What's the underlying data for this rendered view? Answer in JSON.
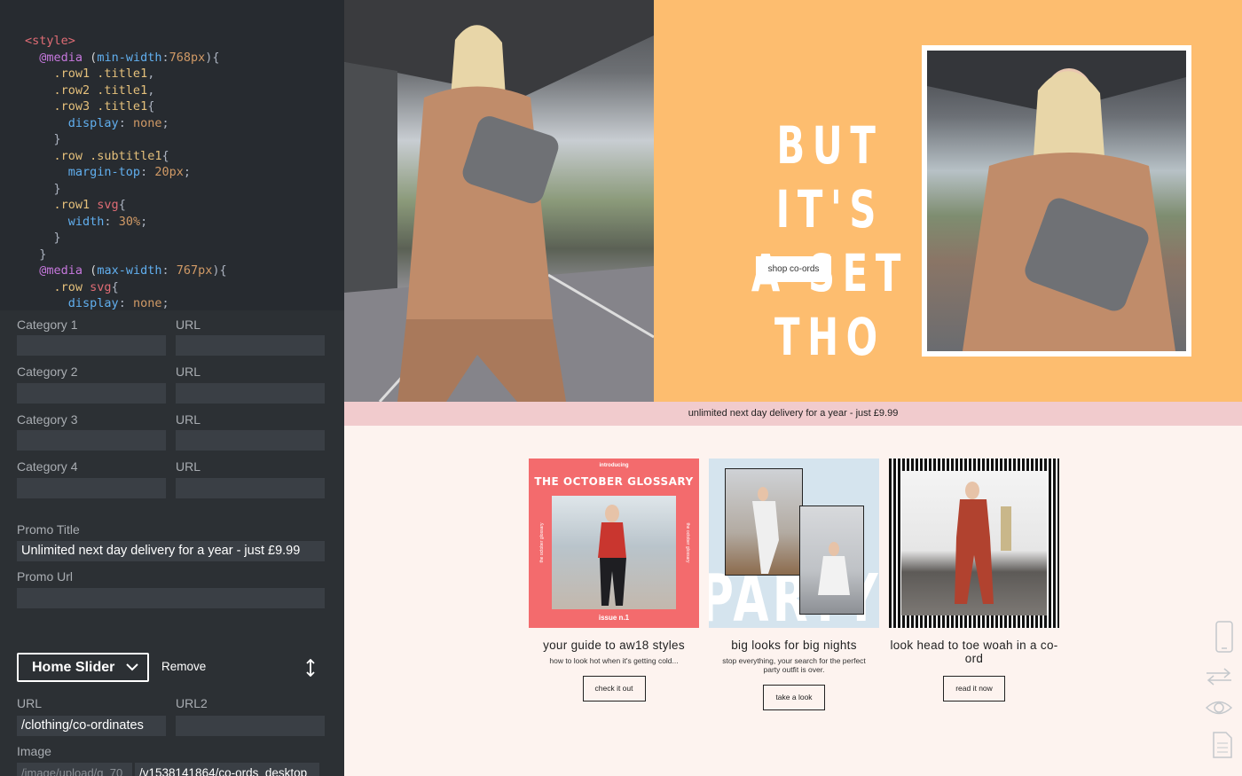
{
  "code": {
    "lines": [
      [
        [
          "tk-tag",
          "<style>"
        ]
      ],
      [
        [
          "tk-txt",
          "  "
        ],
        [
          "tk-at",
          "@media"
        ],
        [
          "tk-txt",
          " ("
        ],
        [
          "tk-prop",
          "min-width"
        ],
        [
          "tk-pun",
          ":"
        ],
        [
          "tk-num",
          "768px"
        ],
        [
          "tk-pun",
          "){"
        ]
      ],
      [
        [
          "tk-txt",
          "    "
        ],
        [
          "tk-sel",
          ".row1"
        ],
        [
          "tk-txt",
          " "
        ],
        [
          "tk-sel",
          ".title1"
        ],
        [
          "tk-pun",
          ","
        ]
      ],
      [
        [
          "tk-txt",
          "    "
        ],
        [
          "tk-sel",
          ".row2"
        ],
        [
          "tk-txt",
          " "
        ],
        [
          "tk-sel",
          ".title1"
        ],
        [
          "tk-pun",
          ","
        ]
      ],
      [
        [
          "tk-txt",
          "    "
        ],
        [
          "tk-sel",
          ".row3"
        ],
        [
          "tk-txt",
          " "
        ],
        [
          "tk-sel",
          ".title1"
        ],
        [
          "tk-pun",
          "{"
        ]
      ],
      [
        [
          "tk-txt",
          "      "
        ],
        [
          "tk-prop",
          "display"
        ],
        [
          "tk-pun",
          ": "
        ],
        [
          "tk-val",
          "none"
        ],
        [
          "tk-pun",
          ";"
        ]
      ],
      [
        [
          "tk-txt",
          "    "
        ],
        [
          "tk-pun",
          "}"
        ]
      ],
      [
        [
          "tk-txt",
          "    "
        ],
        [
          "tk-sel",
          ".row"
        ],
        [
          "tk-txt",
          " "
        ],
        [
          "tk-sel",
          ".subtitle1"
        ],
        [
          "tk-pun",
          "{"
        ]
      ],
      [
        [
          "tk-txt",
          "      "
        ],
        [
          "tk-prop",
          "margin-top"
        ],
        [
          "tk-pun",
          ": "
        ],
        [
          "tk-num",
          "20px"
        ],
        [
          "tk-pun",
          ";"
        ]
      ],
      [
        [
          "tk-txt",
          "    "
        ],
        [
          "tk-pun",
          "}"
        ]
      ],
      [
        [
          "tk-txt",
          "    "
        ],
        [
          "tk-sel",
          ".row1"
        ],
        [
          "tk-txt",
          " "
        ],
        [
          "tk-kw",
          "svg"
        ],
        [
          "tk-pun",
          "{"
        ]
      ],
      [
        [
          "tk-txt",
          "      "
        ],
        [
          "tk-prop",
          "width"
        ],
        [
          "tk-pun",
          ": "
        ],
        [
          "tk-num",
          "30%"
        ],
        [
          "tk-pun",
          ";"
        ]
      ],
      [
        [
          "tk-txt",
          "    "
        ],
        [
          "tk-pun",
          "}"
        ]
      ],
      [
        [
          "tk-txt",
          "  "
        ],
        [
          "tk-pun",
          "}"
        ]
      ],
      [
        [
          "tk-txt",
          "  "
        ],
        [
          "tk-at",
          "@media"
        ],
        [
          "tk-txt",
          " ("
        ],
        [
          "tk-prop",
          "max-width"
        ],
        [
          "tk-pun",
          ": "
        ],
        [
          "tk-num",
          "767px"
        ],
        [
          "tk-pun",
          "){"
        ]
      ],
      [
        [
          "tk-txt",
          "    "
        ],
        [
          "tk-sel",
          ".row"
        ],
        [
          "tk-txt",
          " "
        ],
        [
          "tk-kw",
          "svg"
        ],
        [
          "tk-pun",
          "{"
        ]
      ],
      [
        [
          "tk-txt",
          "      "
        ],
        [
          "tk-prop",
          "display"
        ],
        [
          "tk-pun",
          ": "
        ],
        [
          "tk-val",
          "none"
        ],
        [
          "tk-pun",
          ";"
        ]
      ]
    ]
  },
  "form": {
    "categories": [
      {
        "label": "Category 1",
        "url_label": "URL",
        "value": "",
        "url": ""
      },
      {
        "label": "Category 2",
        "url_label": "URL",
        "value": "",
        "url": ""
      },
      {
        "label": "Category 3",
        "url_label": "URL",
        "value": "",
        "url": ""
      },
      {
        "label": "Category 4",
        "url_label": "URL",
        "value": "",
        "url": ""
      }
    ],
    "promo_title_label": "Promo Title",
    "promo_title_value": "Unlimited next day delivery for a year - just £9.99",
    "promo_url_label": "Promo Url",
    "promo_url_value": "",
    "slider_select": "Home Slider",
    "remove_label": "Remove",
    "url_label": "URL",
    "url_value": "/clothing/co-ordinates",
    "url2_label": "URL2",
    "url2_value": "",
    "image_label": "Image",
    "image_value_1": "/image/upload/q_70",
    "image_value_2": "/v1538141864/co-ords_desktop"
  },
  "preview": {
    "hero_line1": "BUT IT'S",
    "hero_line2": "A SET THO",
    "hero_button": "shop co-ords",
    "promo_bar": "unlimited next day delivery for a year - just £9.99",
    "cards": [
      {
        "title": "your guide to aw18 styles",
        "subtitle": "how to look hot when it's getting cold...",
        "button": "check it out",
        "img_kicker": "introducing",
        "img_heading": "THE OCTOBER GLOSSARY",
        "img_footer": "issue n.1",
        "img_side": "the october glossary"
      },
      {
        "title": "big looks for big nights",
        "subtitle": "stop everything, your search for the perfect party outfit is over.",
        "button": "take a look",
        "img_word": "PARTY"
      },
      {
        "title": "look head to toe woah in a co-ord",
        "subtitle": "",
        "button": "read it now"
      }
    ]
  },
  "colors": {
    "editor_bg": "#2c3034",
    "hero_orange": "#fdbd6f",
    "promo_pink": "#f1cbcd",
    "page_bg": "#fdf3ef",
    "card1_red": "#f36b6d",
    "card2_blue": "#d5e4ee"
  },
  "icons": [
    "chevron-down-icon",
    "reorder-icon",
    "mobile-icon",
    "swap-icon",
    "eye-icon",
    "document-icon"
  ]
}
